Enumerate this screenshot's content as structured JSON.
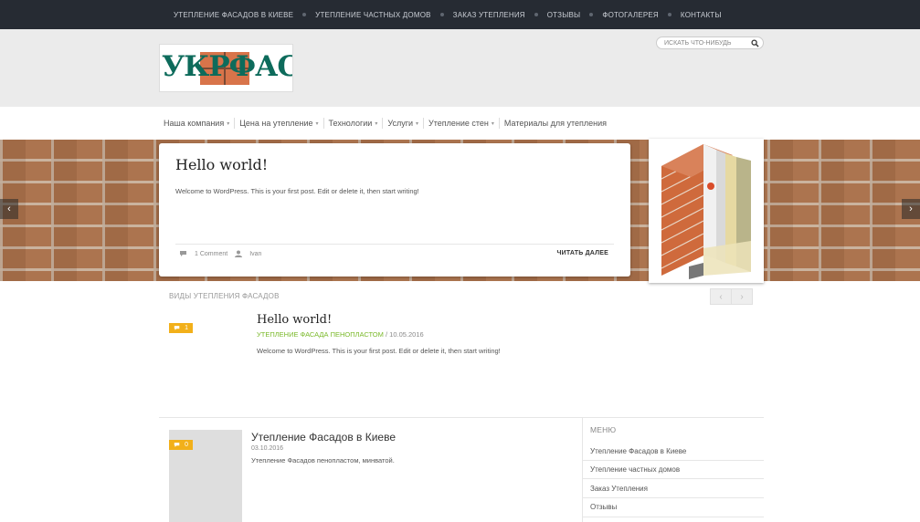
{
  "top_nav": {
    "items": [
      "УТЕПЛЕНИЕ ФАСАДОВ В КИЕВЕ",
      "УТЕПЛЕНИЕ ЧАСТНЫХ ДОМОВ",
      "ЗАКАЗ УТЕПЛЕНИЯ",
      "ОТЗЫВЫ",
      "ФОТОГАЛЕРЕЯ",
      "КОНТАКТЫ"
    ]
  },
  "header": {
    "logo_text": "УКРФАСАД",
    "search_placeholder": "ИСКАТЬ ЧТО-НИБУДЬ"
  },
  "main_nav": {
    "items": [
      {
        "label": "Наша компания",
        "dropdown": true
      },
      {
        "label": "Цена на утепление",
        "dropdown": true
      },
      {
        "label": "Технологии",
        "dropdown": true
      },
      {
        "label": "Услуги",
        "dropdown": true
      },
      {
        "label": "Утепление стен",
        "dropdown": true
      },
      {
        "label": "Материалы для утепления",
        "dropdown": false
      }
    ]
  },
  "slider": {
    "title": "Hello world!",
    "excerpt": "Welcome to WordPress. This is your first post. Edit or delete it, then start writing!",
    "comments": "1 Comment",
    "author": "Ivan",
    "read_more": "ЧИТАТЬ ДАЛЕЕ",
    "prev": "‹",
    "next": "›"
  },
  "section": {
    "title": "ВИДЫ УТЕПЛЕНИЯ ФАСАДОВ",
    "post": {
      "comment_count": "1",
      "title": "Hello world!",
      "category": "УТЕПЛЕНИЕ ФАСАДА ПЕНОПЛАСТОМ",
      "date": "10.05.2016",
      "excerpt": "Welcome to WordPress. This is your first post. Edit or delete it, then start writing!"
    }
  },
  "latest_post": {
    "comment_count": "0",
    "title": "Утепление Фасадов в Киеве",
    "date": "03.10.2016",
    "excerpt": "Утепление Фасадов пенопластом, минватой."
  },
  "sidebar": {
    "title": "МЕНЮ",
    "items": [
      "Утепление Фасадов в Киеве",
      "Утепление частных домов",
      "Заказ Утепления",
      "Отзывы"
    ]
  },
  "colors": {
    "topbar": "#262b33",
    "badge": "#f2b01a",
    "category": "#7ab929"
  }
}
